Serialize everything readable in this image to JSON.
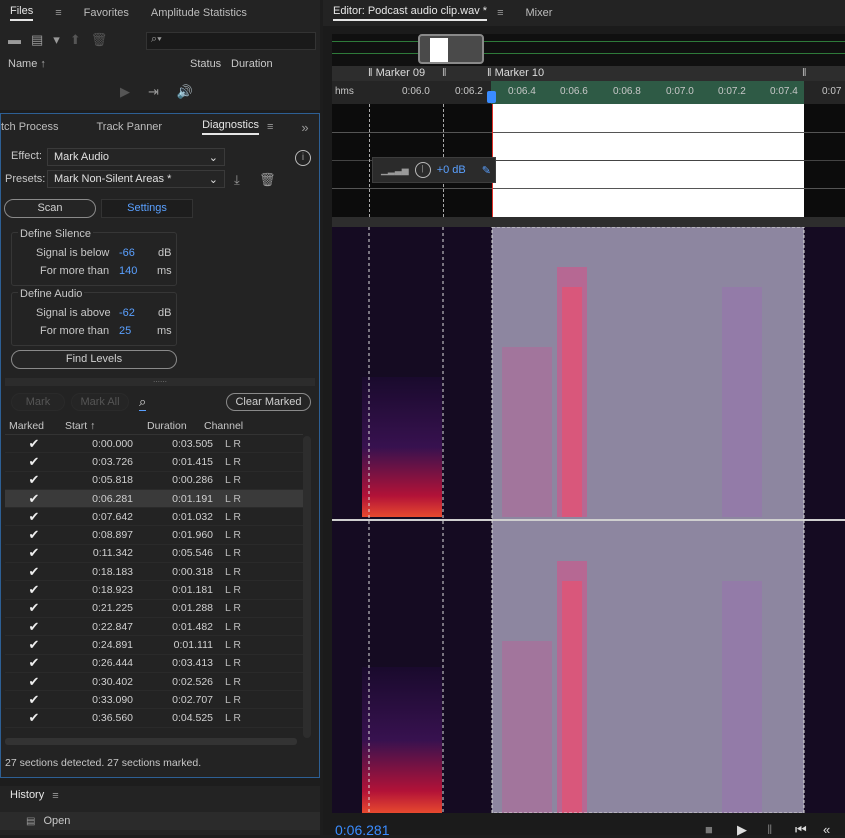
{
  "files_panel": {
    "tabs": [
      "Files",
      "Favorites",
      "Amplitude Statistics"
    ],
    "columns": {
      "name": "Name",
      "status": "Status",
      "duration": "Duration"
    }
  },
  "effects_panel": {
    "tabs": [
      "tch Process",
      "Track Panner",
      "Diagnostics"
    ],
    "effect_label": "Effect:",
    "effect_value": "Mark Audio",
    "presets_label": "Presets:",
    "presets_value": "Mark Non-Silent Areas *",
    "scan_label": "Scan",
    "settings_label": "Settings",
    "silence": {
      "title": "Define Silence",
      "signal_label": "Signal is below",
      "signal_value": "-66",
      "signal_unit": "dB",
      "more_label": "For more than",
      "more_value": "140",
      "more_unit": "ms"
    },
    "audio": {
      "title": "Define Audio",
      "signal_label": "Signal is above",
      "signal_value": "-62",
      "signal_unit": "dB",
      "more_label": "For more than",
      "more_value": "25",
      "more_unit": "ms"
    },
    "find_levels": "Find Levels",
    "mark": "Mark",
    "mark_all": "Mark All",
    "clear_marked": "Clear Marked",
    "columns": [
      "Marked",
      "Start",
      "Duration",
      "Channel"
    ],
    "rows": [
      {
        "start": "0:00.000",
        "duration": "0:03.505",
        "channel": "L R"
      },
      {
        "start": "0:03.726",
        "duration": "0:01.415",
        "channel": "L R"
      },
      {
        "start": "0:05.818",
        "duration": "0:00.286",
        "channel": "L R"
      },
      {
        "start": "0:06.281",
        "duration": "0:01.191",
        "channel": "L R",
        "selected": true
      },
      {
        "start": "0:07.642",
        "duration": "0:01.032",
        "channel": "L R"
      },
      {
        "start": "0:08.897",
        "duration": "0:01.960",
        "channel": "L R"
      },
      {
        "start": "0:11.342",
        "duration": "0:05.546",
        "channel": "L R"
      },
      {
        "start": "0:18.183",
        "duration": "0:00.318",
        "channel": "L R"
      },
      {
        "start": "0:18.923",
        "duration": "0:01.181",
        "channel": "L R"
      },
      {
        "start": "0:21.225",
        "duration": "0:01.288",
        "channel": "L R"
      },
      {
        "start": "0:22.847",
        "duration": "0:01.482",
        "channel": "L R"
      },
      {
        "start": "0:24.891",
        "duration": "0:01.111",
        "channel": "L R"
      },
      {
        "start": "0:26.444",
        "duration": "0:03.413",
        "channel": "L R"
      },
      {
        "start": "0:30.402",
        "duration": "0:02.526",
        "channel": "L R"
      },
      {
        "start": "0:33.090",
        "duration": "0:02.707",
        "channel": "L R"
      },
      {
        "start": "0:36.560",
        "duration": "0:04.525",
        "channel": "L R"
      }
    ],
    "status": "27 sections detected. 27 sections marked."
  },
  "history": {
    "title": "History",
    "item": "Open"
  },
  "editor": {
    "tab": "Editor: Podcast audio clip.wav *",
    "mixer": "Mixer",
    "markers": [
      "Marker 09",
      "Marker 10"
    ],
    "ruler": [
      "hms",
      "0:06.0",
      "0:06.2",
      "0:06.4",
      "0:06.6",
      "0:06.8",
      "0:07.0",
      "0:07.2",
      "0:07.4",
      "0:07"
    ],
    "gain": "+0 dB",
    "timecode": "0:06.281"
  }
}
